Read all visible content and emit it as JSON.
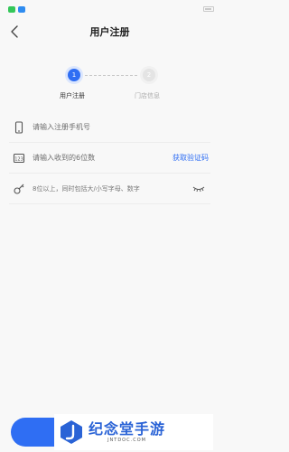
{
  "status_bar": {
    "left_text": "",
    "right_text": ""
  },
  "header": {
    "title": "用户注册"
  },
  "steps": [
    {
      "number": "1",
      "label": "用户注册",
      "active": true
    },
    {
      "number": "2",
      "label": "门店信息",
      "active": false
    }
  ],
  "form": {
    "phone_placeholder": "请输入注册手机号",
    "code_placeholder": "请输入收到的6位数",
    "get_code_label": "获取验证码",
    "password_placeholder": "8位以上，同时包括大/小写字母、数字"
  },
  "watermark": {
    "title": "纪念堂手游",
    "url": "JNTDOC.COM"
  },
  "colors": {
    "accent": "#2f6ef3",
    "background": "#f8f8f8"
  }
}
